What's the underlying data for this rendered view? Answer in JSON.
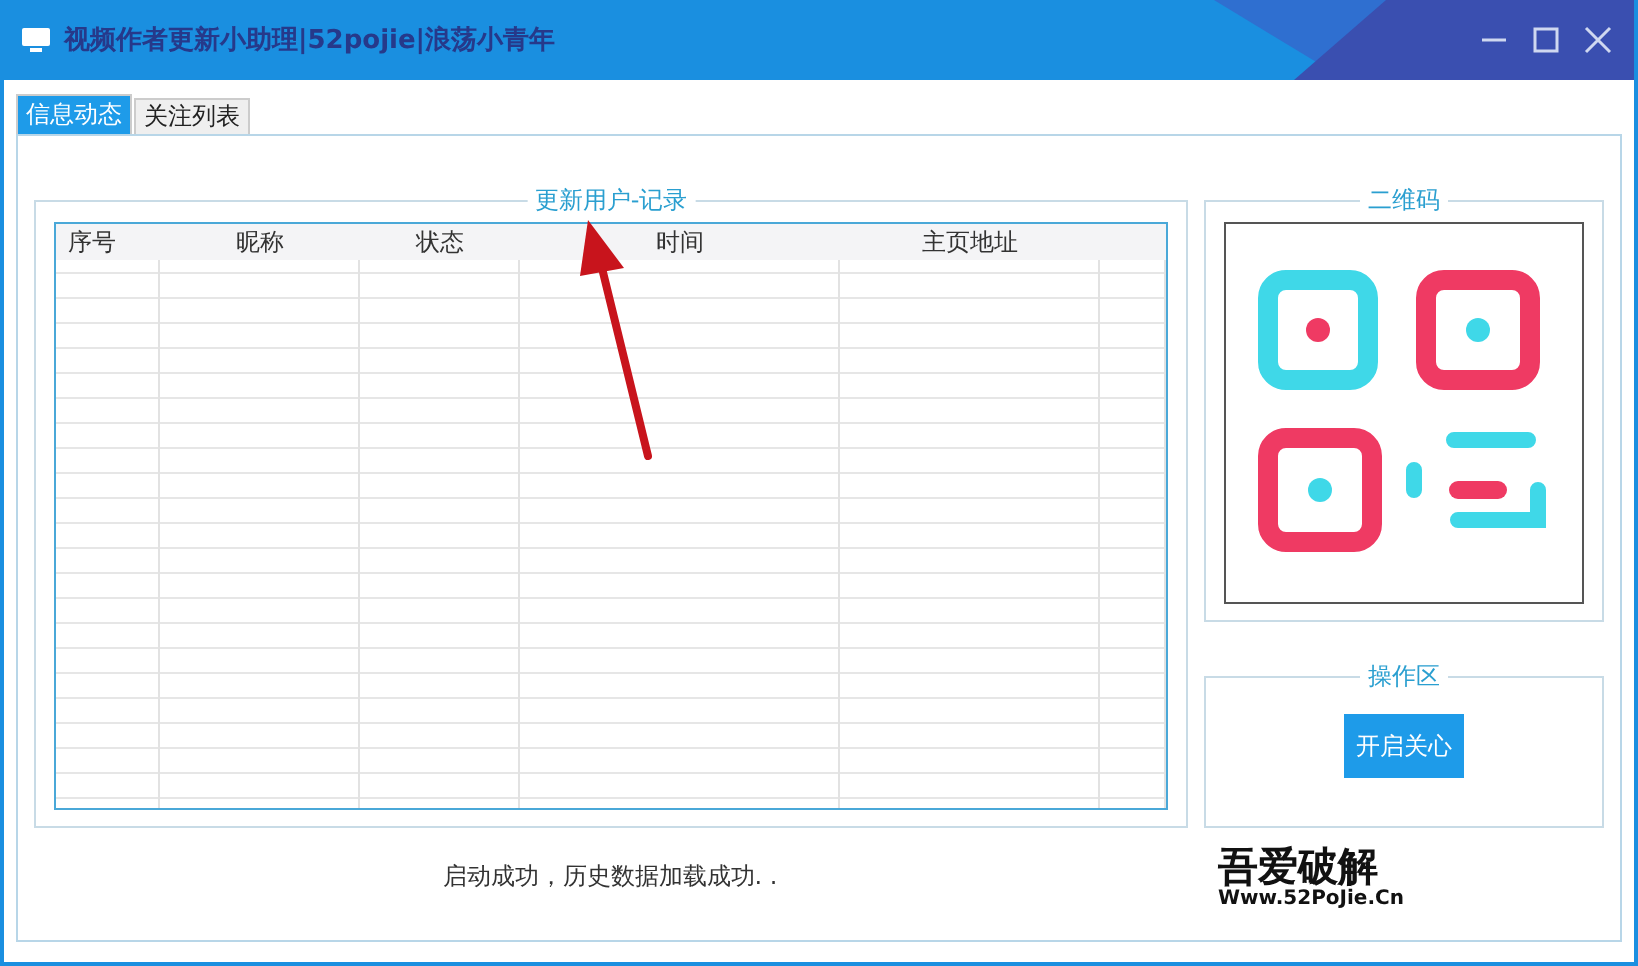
{
  "window": {
    "title": "视频作者更新小助理|52pojie|浪荡小青年"
  },
  "tabs": [
    {
      "label": "信息动态",
      "selected": true
    },
    {
      "label": "关注列表",
      "selected": false
    }
  ],
  "records": {
    "title": "更新用户-记录",
    "table": {
      "columns": [
        "序号",
        "昵称",
        "状态",
        "时间",
        "主页地址"
      ]
    }
  },
  "qr": {
    "title": "二维码"
  },
  "actions": {
    "title": "操作区",
    "buttons": [
      "开启关心"
    ]
  },
  "status": "启动成功，历史数据加载成功. .",
  "logo": {
    "name": "吾爱破解",
    "url": "Www.52PoJie.Cn"
  }
}
